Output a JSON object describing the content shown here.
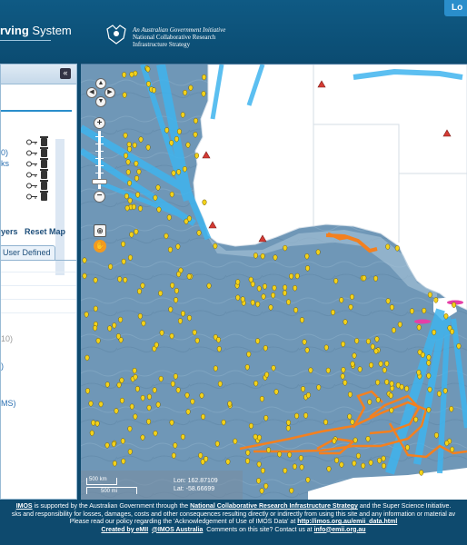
{
  "header": {
    "brand_bold": "rving",
    "brand_rest": " System",
    "gov_line1": "An Australian Government Initiative",
    "gov_line2": "National Collaborative Research",
    "gov_line3": "Infrastructure Strategy",
    "login_label": "Lo"
  },
  "left_panel": {
    "collapse_label": "«",
    "layer_rows": [
      "",
      "0)",
      "ks",
      "",
      "",
      ""
    ],
    "layers_button": "yers",
    "reset_button": "Reset Map",
    "user_tab": "User Defined",
    "fragments": [
      "10)",
      ")",
      "MS)"
    ]
  },
  "map": {
    "scale_top": "500 km",
    "scale_bottom": "500 mi",
    "lon_label": "Lon: 162.87109",
    "lat_label": "Lat: -58.66699",
    "colors": {
      "ocean": "#6f97b7",
      "land": "#ffffff",
      "tracks_blue": "#3fb4ee",
      "tracks_orange": "#f4801f",
      "float_yellow": "#f3d21b",
      "warning_red": "#d43a33",
      "glider_magenta": "#e63ea7"
    },
    "icons": [
      "pan-up-icon",
      "pan-left-icon",
      "pan-right-icon",
      "pan-down-icon",
      "zoom-in-icon",
      "zoom-out-icon",
      "float-marker-icon",
      "warning-triangle-icon"
    ]
  },
  "footer": {
    "l1_a": "IMOS",
    "l1_b": " is supported by the Australian Government through the ",
    "l1_c": "National Collaborative Research Infrastructure Strategy",
    "l1_d": " and the Super Science Initiative.",
    "l2": "sks and responsibility for losses, damages, costs and other consequences resulting directly or indirectly from using this site and any information or material av",
    "l3_a": "Please read our policy regarding the 'Acknowledgement of Use of IMOS Data' at ",
    "l3_b": "http://imos.org.au/emii_data.html",
    "l4_a": "Created by eMII",
    "l4_b": "@IMOS Australia",
    "l4_c": "Comments on this site? Contact us at ",
    "l4_d": "info@emii.org.au"
  }
}
